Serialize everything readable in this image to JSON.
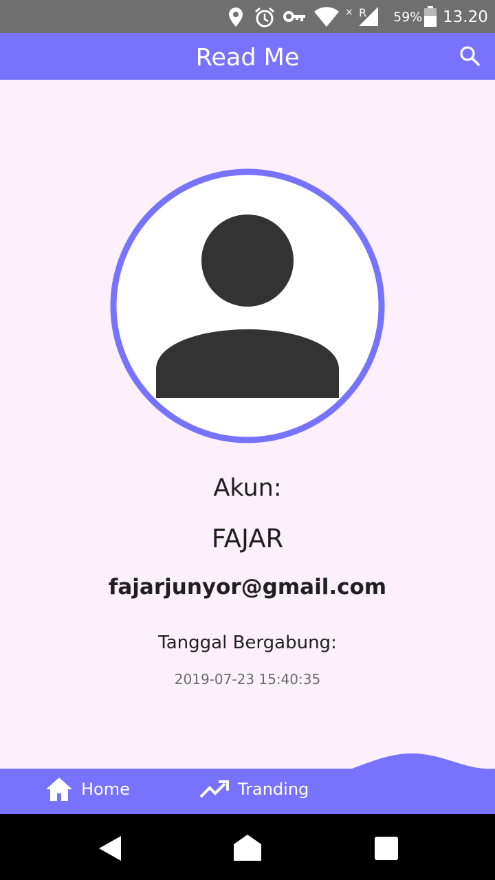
{
  "status_bar": {
    "battery_percent": "59%",
    "time": "13.20",
    "icons": [
      "location-icon",
      "alarm-icon",
      "vpn-key-icon",
      "wifi-icon",
      "signal-icon",
      "battery-icon"
    ]
  },
  "app_bar": {
    "title": "Read Me",
    "search_icon": "search-icon"
  },
  "profile": {
    "avatar_icon": "person-icon",
    "account_label": "Akun:",
    "name": "FAJAR",
    "email": "fajarjunyor@gmail.com",
    "join_label": "Tanggal Bergabung:",
    "join_date": "2019-07-23 15:40:35"
  },
  "bottom_nav": {
    "items": [
      {
        "label": "Home",
        "icon": "home-icon"
      },
      {
        "label": "Tranding",
        "icon": "trending-up-icon"
      }
    ]
  },
  "system_nav": {
    "buttons": [
      "back-icon",
      "home-nav-icon",
      "recents-icon"
    ]
  },
  "colors": {
    "primary": "#7873fe",
    "background": "#fbf0fb",
    "status_bar": "#6f6f6f",
    "avatar_fill": "#333333"
  }
}
